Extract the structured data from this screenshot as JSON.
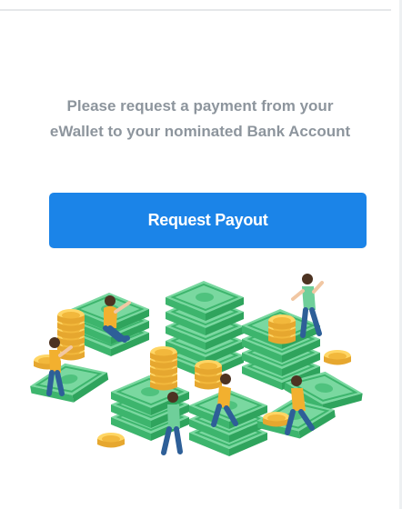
{
  "panel": {
    "message": "Please request a payment from your eWallet to your nominated Bank Account",
    "request_payout_label": "Request Payout"
  },
  "colors": {
    "accent": "#1b84e8",
    "message_text": "#8d959d",
    "money_green": "#72d79a",
    "coin_gold": "#f4c04d"
  },
  "icons": {
    "illustration": "money-coins-people-illustration"
  }
}
